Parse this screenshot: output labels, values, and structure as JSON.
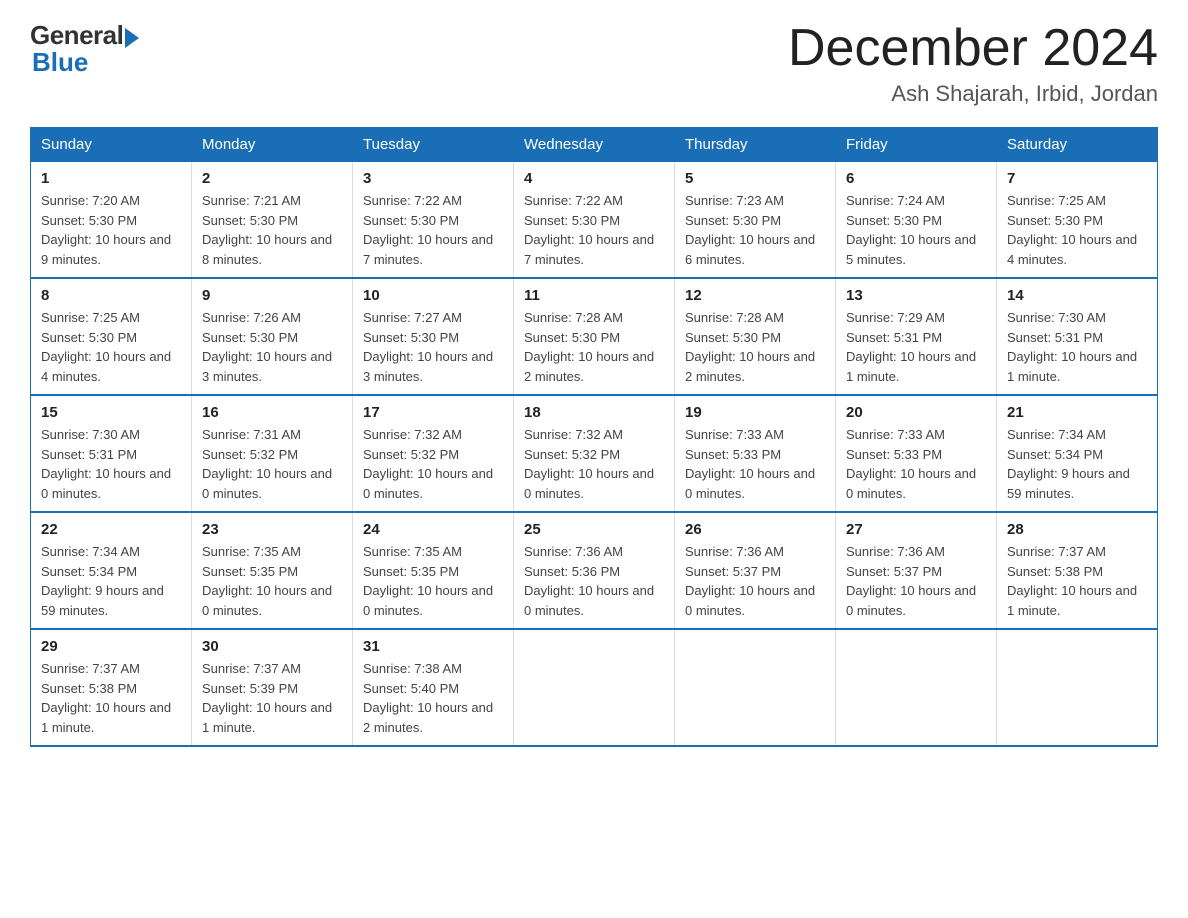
{
  "logo": {
    "general": "General",
    "blue": "Blue"
  },
  "title": "December 2024",
  "location": "Ash Shajarah, Irbid, Jordan",
  "headers": [
    "Sunday",
    "Monday",
    "Tuesday",
    "Wednesday",
    "Thursday",
    "Friday",
    "Saturday"
  ],
  "weeks": [
    [
      {
        "day": "1",
        "sunrise": "7:20 AM",
        "sunset": "5:30 PM",
        "daylight": "10 hours and 9 minutes."
      },
      {
        "day": "2",
        "sunrise": "7:21 AM",
        "sunset": "5:30 PM",
        "daylight": "10 hours and 8 minutes."
      },
      {
        "day": "3",
        "sunrise": "7:22 AM",
        "sunset": "5:30 PM",
        "daylight": "10 hours and 7 minutes."
      },
      {
        "day": "4",
        "sunrise": "7:22 AM",
        "sunset": "5:30 PM",
        "daylight": "10 hours and 7 minutes."
      },
      {
        "day": "5",
        "sunrise": "7:23 AM",
        "sunset": "5:30 PM",
        "daylight": "10 hours and 6 minutes."
      },
      {
        "day": "6",
        "sunrise": "7:24 AM",
        "sunset": "5:30 PM",
        "daylight": "10 hours and 5 minutes."
      },
      {
        "day": "7",
        "sunrise": "7:25 AM",
        "sunset": "5:30 PM",
        "daylight": "10 hours and 4 minutes."
      }
    ],
    [
      {
        "day": "8",
        "sunrise": "7:25 AM",
        "sunset": "5:30 PM",
        "daylight": "10 hours and 4 minutes."
      },
      {
        "day": "9",
        "sunrise": "7:26 AM",
        "sunset": "5:30 PM",
        "daylight": "10 hours and 3 minutes."
      },
      {
        "day": "10",
        "sunrise": "7:27 AM",
        "sunset": "5:30 PM",
        "daylight": "10 hours and 3 minutes."
      },
      {
        "day": "11",
        "sunrise": "7:28 AM",
        "sunset": "5:30 PM",
        "daylight": "10 hours and 2 minutes."
      },
      {
        "day": "12",
        "sunrise": "7:28 AM",
        "sunset": "5:30 PM",
        "daylight": "10 hours and 2 minutes."
      },
      {
        "day": "13",
        "sunrise": "7:29 AM",
        "sunset": "5:31 PM",
        "daylight": "10 hours and 1 minute."
      },
      {
        "day": "14",
        "sunrise": "7:30 AM",
        "sunset": "5:31 PM",
        "daylight": "10 hours and 1 minute."
      }
    ],
    [
      {
        "day": "15",
        "sunrise": "7:30 AM",
        "sunset": "5:31 PM",
        "daylight": "10 hours and 0 minutes."
      },
      {
        "day": "16",
        "sunrise": "7:31 AM",
        "sunset": "5:32 PM",
        "daylight": "10 hours and 0 minutes."
      },
      {
        "day": "17",
        "sunrise": "7:32 AM",
        "sunset": "5:32 PM",
        "daylight": "10 hours and 0 minutes."
      },
      {
        "day": "18",
        "sunrise": "7:32 AM",
        "sunset": "5:32 PM",
        "daylight": "10 hours and 0 minutes."
      },
      {
        "day": "19",
        "sunrise": "7:33 AM",
        "sunset": "5:33 PM",
        "daylight": "10 hours and 0 minutes."
      },
      {
        "day": "20",
        "sunrise": "7:33 AM",
        "sunset": "5:33 PM",
        "daylight": "10 hours and 0 minutes."
      },
      {
        "day": "21",
        "sunrise": "7:34 AM",
        "sunset": "5:34 PM",
        "daylight": "9 hours and 59 minutes."
      }
    ],
    [
      {
        "day": "22",
        "sunrise": "7:34 AM",
        "sunset": "5:34 PM",
        "daylight": "9 hours and 59 minutes."
      },
      {
        "day": "23",
        "sunrise": "7:35 AM",
        "sunset": "5:35 PM",
        "daylight": "10 hours and 0 minutes."
      },
      {
        "day": "24",
        "sunrise": "7:35 AM",
        "sunset": "5:35 PM",
        "daylight": "10 hours and 0 minutes."
      },
      {
        "day": "25",
        "sunrise": "7:36 AM",
        "sunset": "5:36 PM",
        "daylight": "10 hours and 0 minutes."
      },
      {
        "day": "26",
        "sunrise": "7:36 AM",
        "sunset": "5:37 PM",
        "daylight": "10 hours and 0 minutes."
      },
      {
        "day": "27",
        "sunrise": "7:36 AM",
        "sunset": "5:37 PM",
        "daylight": "10 hours and 0 minutes."
      },
      {
        "day": "28",
        "sunrise": "7:37 AM",
        "sunset": "5:38 PM",
        "daylight": "10 hours and 1 minute."
      }
    ],
    [
      {
        "day": "29",
        "sunrise": "7:37 AM",
        "sunset": "5:38 PM",
        "daylight": "10 hours and 1 minute."
      },
      {
        "day": "30",
        "sunrise": "7:37 AM",
        "sunset": "5:39 PM",
        "daylight": "10 hours and 1 minute."
      },
      {
        "day": "31",
        "sunrise": "7:38 AM",
        "sunset": "5:40 PM",
        "daylight": "10 hours and 2 minutes."
      },
      null,
      null,
      null,
      null
    ]
  ],
  "labels": {
    "sunrise_prefix": "Sunrise: ",
    "sunset_prefix": "Sunset: ",
    "daylight_prefix": "Daylight: "
  }
}
